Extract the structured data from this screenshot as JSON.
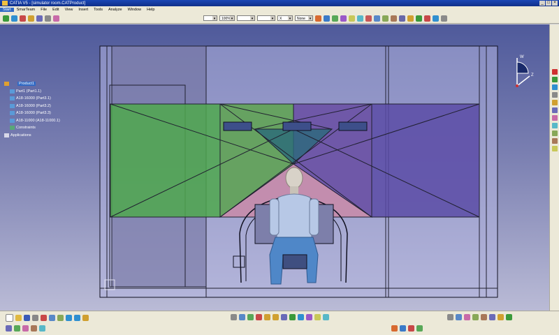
{
  "window": {
    "title": "CATIA V5 - [simulator room.CATProduct]",
    "buttons": [
      "_",
      "□",
      "×"
    ]
  },
  "menu": {
    "items": [
      "Start",
      "SmarTeam",
      "File",
      "Edit",
      "View",
      "Insert",
      "Tools",
      "Analyze",
      "Window",
      "Help"
    ]
  },
  "toolbar": {
    "combo_1": "",
    "combo_zoom": "100%",
    "combo_3": "",
    "combo_4": "",
    "combo_5": "",
    "combo_6": "X",
    "combo_none": "None"
  },
  "tree": {
    "root": "Product1",
    "nodes": [
      "Part1 (Part1.1)",
      "A18-16000 (Part3.1)",
      "A18-16000 (Part3.2)",
      "A18-16000 (Part3.3)",
      "A18-11000 (A18-11000.1)",
      "Constraints",
      "Applications"
    ]
  },
  "compass": {
    "axis_top": "W",
    "axis_right": "Z"
  },
  "colors": {
    "green_plane": "#4fa84e",
    "purple_plane": "#5a4ba6",
    "pink_plane": "#c98aa8",
    "mannequin_body": "#b7c8e6",
    "mannequin_legs": "#4f87c8",
    "viewport_top": "#4f5a9b",
    "viewport_bottom": "#babbd6"
  }
}
